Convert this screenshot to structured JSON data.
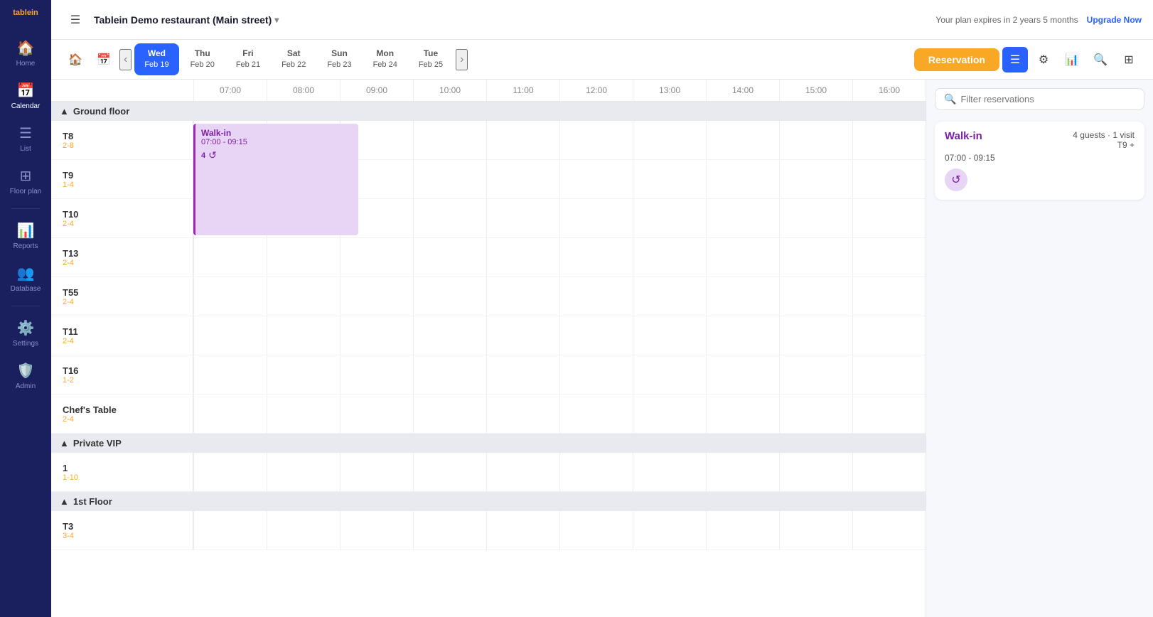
{
  "app": {
    "logo_line1": "table",
    "logo_line2": "in"
  },
  "sidebar": {
    "items": [
      {
        "id": "home",
        "label": "Home",
        "icon": "🏠",
        "active": false
      },
      {
        "id": "calendar",
        "label": "Calendar",
        "icon": "📅",
        "active": true
      },
      {
        "id": "list",
        "label": "List",
        "icon": "☰",
        "active": false
      },
      {
        "id": "floor-plan",
        "label": "Floor plan",
        "icon": "⊞",
        "active": false
      },
      {
        "id": "reports",
        "label": "Reports",
        "icon": "📊",
        "active": false
      },
      {
        "id": "database",
        "label": "Database",
        "icon": "👥",
        "active": false
      },
      {
        "id": "settings",
        "label": "Settings",
        "icon": "⚙️",
        "active": false
      },
      {
        "id": "admin",
        "label": "Admin",
        "icon": "🛡️",
        "active": false
      }
    ]
  },
  "topbar": {
    "restaurant_name": "Tablein Demo restaurant (Main street)",
    "plan_text": "Your plan expires in 2 years 5 months",
    "upgrade_label": "Upgrade Now"
  },
  "navbar": {
    "dates": [
      {
        "dow": "Wed",
        "day": "Feb 19",
        "active": true
      },
      {
        "dow": "Thu",
        "day": "Feb 20",
        "active": false
      },
      {
        "dow": "Fri",
        "day": "Feb 21",
        "active": false
      },
      {
        "dow": "Sat",
        "day": "Feb 22",
        "active": false
      },
      {
        "dow": "Sun",
        "day": "Feb 23",
        "active": false
      },
      {
        "dow": "Mon",
        "day": "Feb 24",
        "active": false
      },
      {
        "dow": "Tue",
        "day": "Feb 25",
        "active": false
      }
    ],
    "reservation_btn": "Reservation"
  },
  "time_slots": [
    "07:00",
    "08:00",
    "09:00",
    "10:00",
    "11:00",
    "12:00",
    "13:00",
    "14:00",
    "15:00",
    "16:00"
  ],
  "sections": [
    {
      "id": "ground-floor",
      "name": "Ground floor",
      "expanded": true,
      "tables": [
        {
          "name": "T8",
          "capacity": "2-8"
        },
        {
          "name": "T9",
          "capacity": "1-4"
        },
        {
          "name": "T10",
          "capacity": "2-4"
        },
        {
          "name": "T13",
          "capacity": "2-4"
        },
        {
          "name": "T55",
          "capacity": "2-4"
        },
        {
          "name": "T11",
          "capacity": "2-4"
        },
        {
          "name": "T16",
          "capacity": "1-2"
        },
        {
          "name": "Chef's Table",
          "capacity": "2-4"
        }
      ]
    },
    {
      "id": "private-vip",
      "name": "Private VIP",
      "expanded": true,
      "tables": [
        {
          "name": "1",
          "capacity": "1-10"
        }
      ]
    },
    {
      "id": "1st-floor",
      "name": "1st Floor",
      "expanded": true,
      "tables": [
        {
          "name": "T3",
          "capacity": "3-4"
        }
      ]
    }
  ],
  "reservation": {
    "title": "Walk-in",
    "time": "07:00 - 09:15",
    "guests": "4",
    "table": "T9 +"
  },
  "right_panel": {
    "filter_placeholder": "Filter reservations",
    "card": {
      "title": "Walk-in",
      "guests_label": "4 guests · 1 visit",
      "time": "07:00 - 09:15",
      "table": "T9 +"
    }
  }
}
